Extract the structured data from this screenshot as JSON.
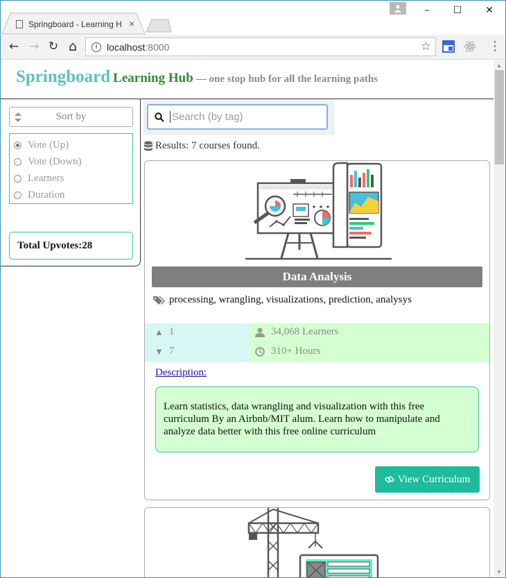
{
  "browser": {
    "tab_title": "Springboard - Learning H",
    "tab_close": "×",
    "url_host": "localhost",
    "url_port": ":8000",
    "minimize": "–",
    "maximize": "☐",
    "close": "✕",
    "back": "←",
    "forward": "→",
    "reload": "↻",
    "home": "⌂",
    "star": "☆",
    "menu": "⋮"
  },
  "header": {
    "brand_main": "Springboard",
    "brand_sub": "Learning Hub",
    "tagline": "— one stop hub for all the learning paths"
  },
  "sidebar": {
    "sort_label": "Sort by",
    "sort_options": [
      "Vote (Up)",
      "Vote (Down)",
      "Learners",
      "Duration"
    ],
    "selected": "Vote (Up)",
    "total_upvotes_label": "Total Upvotes:",
    "total_upvotes_value": "28"
  },
  "search": {
    "placeholder": "Search (by tag)",
    "value": ""
  },
  "results": {
    "text": "Results: 7 courses found."
  },
  "course": {
    "title": "Data Analysis",
    "tags": "processing, wrangling, visualizations, prediction, analysys",
    "upvotes": "1",
    "downvotes": "7",
    "learners": "34,068 Learners",
    "hours": "310+ Hours",
    "description_link": "Description:",
    "description": "Learn statistics, data wrangling and visualization with this free curriculum By an Airbnb/MIT alum. Learn how to manipulate and analyze data better with this free online curriculum",
    "button": "View Curriculum"
  },
  "colors": {
    "brand_teal": "#5bc3b5",
    "brand_green": "#2e8b3a",
    "accent_button": "#1cbc9c",
    "border_teal": "#37c0ad",
    "stats_left_bg": "#d6f7f4",
    "stats_right_bg": "#d4ffd0",
    "title_bar_bg": "#7f7f7f"
  }
}
